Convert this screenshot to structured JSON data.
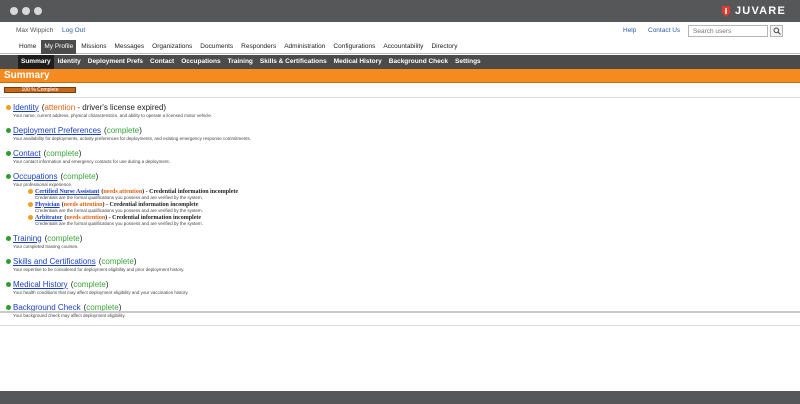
{
  "app": {
    "brand": "JUVARE",
    "brand_color": "#e03a2e"
  },
  "userbar": {
    "user_name": "Max Wippich",
    "logout": "Log Out",
    "help": "Help",
    "contact_us": "Contact Us",
    "search_placeholder": "Search users"
  },
  "main_nav": [
    "Home",
    "My Profile",
    "Missions",
    "Messages",
    "Organizations",
    "Documents",
    "Responders",
    "Administration",
    "Configurations",
    "Accountability",
    "Directory"
  ],
  "main_nav_active": "My Profile",
  "sub_nav": [
    "Summary",
    "Identity",
    "Deployment Prefs",
    "Contact",
    "Occupations",
    "Training",
    "Skills & Certifications",
    "Medical History",
    "Background Check",
    "Settings"
  ],
  "sub_nav_active": "Summary",
  "page": {
    "title": "Summary",
    "progress_label": "100 % Complete",
    "progress_value": 1.0
  },
  "sections": [
    {
      "title": "Identity",
      "status": "warn",
      "state_word": "attention",
      "state_rest": " - driver's license expired",
      "desc": "Your name, current address, physical characteristics, and ability to operate a licensed motor vehicle."
    },
    {
      "title": "Deployment Preferences",
      "status": "ok",
      "state_word": "complete",
      "state_rest": "",
      "desc": "Your availability for deployments, activity preferences for deployments, and existing emergency response commitments."
    },
    {
      "title": "Contact",
      "status": "ok",
      "state_word": "complete",
      "state_rest": "",
      "desc": "Your contact information and emergency contacts for use during a deployment."
    },
    {
      "title": "Occupations",
      "status": "ok",
      "state_word": "complete",
      "state_rest": "",
      "desc": "Your professional experience.",
      "items": [
        {
          "title": "Certified Nurse Assistant",
          "state_word": "needs attention",
          "state_rest": " - Credential information incomplete",
          "desc": "Credentials are the formal qualifications you possess and are verified by the system."
        },
        {
          "title": "Physician",
          "state_word": "needs attention",
          "state_rest": " - Credential information incomplete",
          "desc": "Credentials are the formal qualifications you possess and are verified by the system."
        },
        {
          "title": "Arbitrator",
          "state_word": "needs attention",
          "state_rest": " - Credential information incomplete",
          "desc": "Credentials are the formal qualifications you possess and are verified by the system."
        }
      ]
    },
    {
      "title": "Training",
      "status": "ok",
      "state_word": "complete",
      "state_rest": "",
      "desc": "Your completed training courses."
    },
    {
      "title": "Skills and Certifications",
      "status": "ok",
      "state_word": "complete",
      "state_rest": "",
      "desc": "Your expertise to be considered for deployment eligibility and prior deployment history."
    },
    {
      "title": "Medical History",
      "status": "ok",
      "state_word": "complete",
      "state_rest": "",
      "desc": "Your health conditions that may affect deployment eligibility and your vaccination history."
    },
    {
      "title": "Background Check",
      "status": "ok",
      "state_word": "complete",
      "state_rest": "",
      "desc": "Your background check may affect deployment eligibility."
    }
  ],
  "colors": {
    "orange": "#f58a1f",
    "nav_dark": "#4b4b4b",
    "complete": "#3aa53a",
    "attention": "#e06010",
    "link": "#1a3fc8"
  }
}
